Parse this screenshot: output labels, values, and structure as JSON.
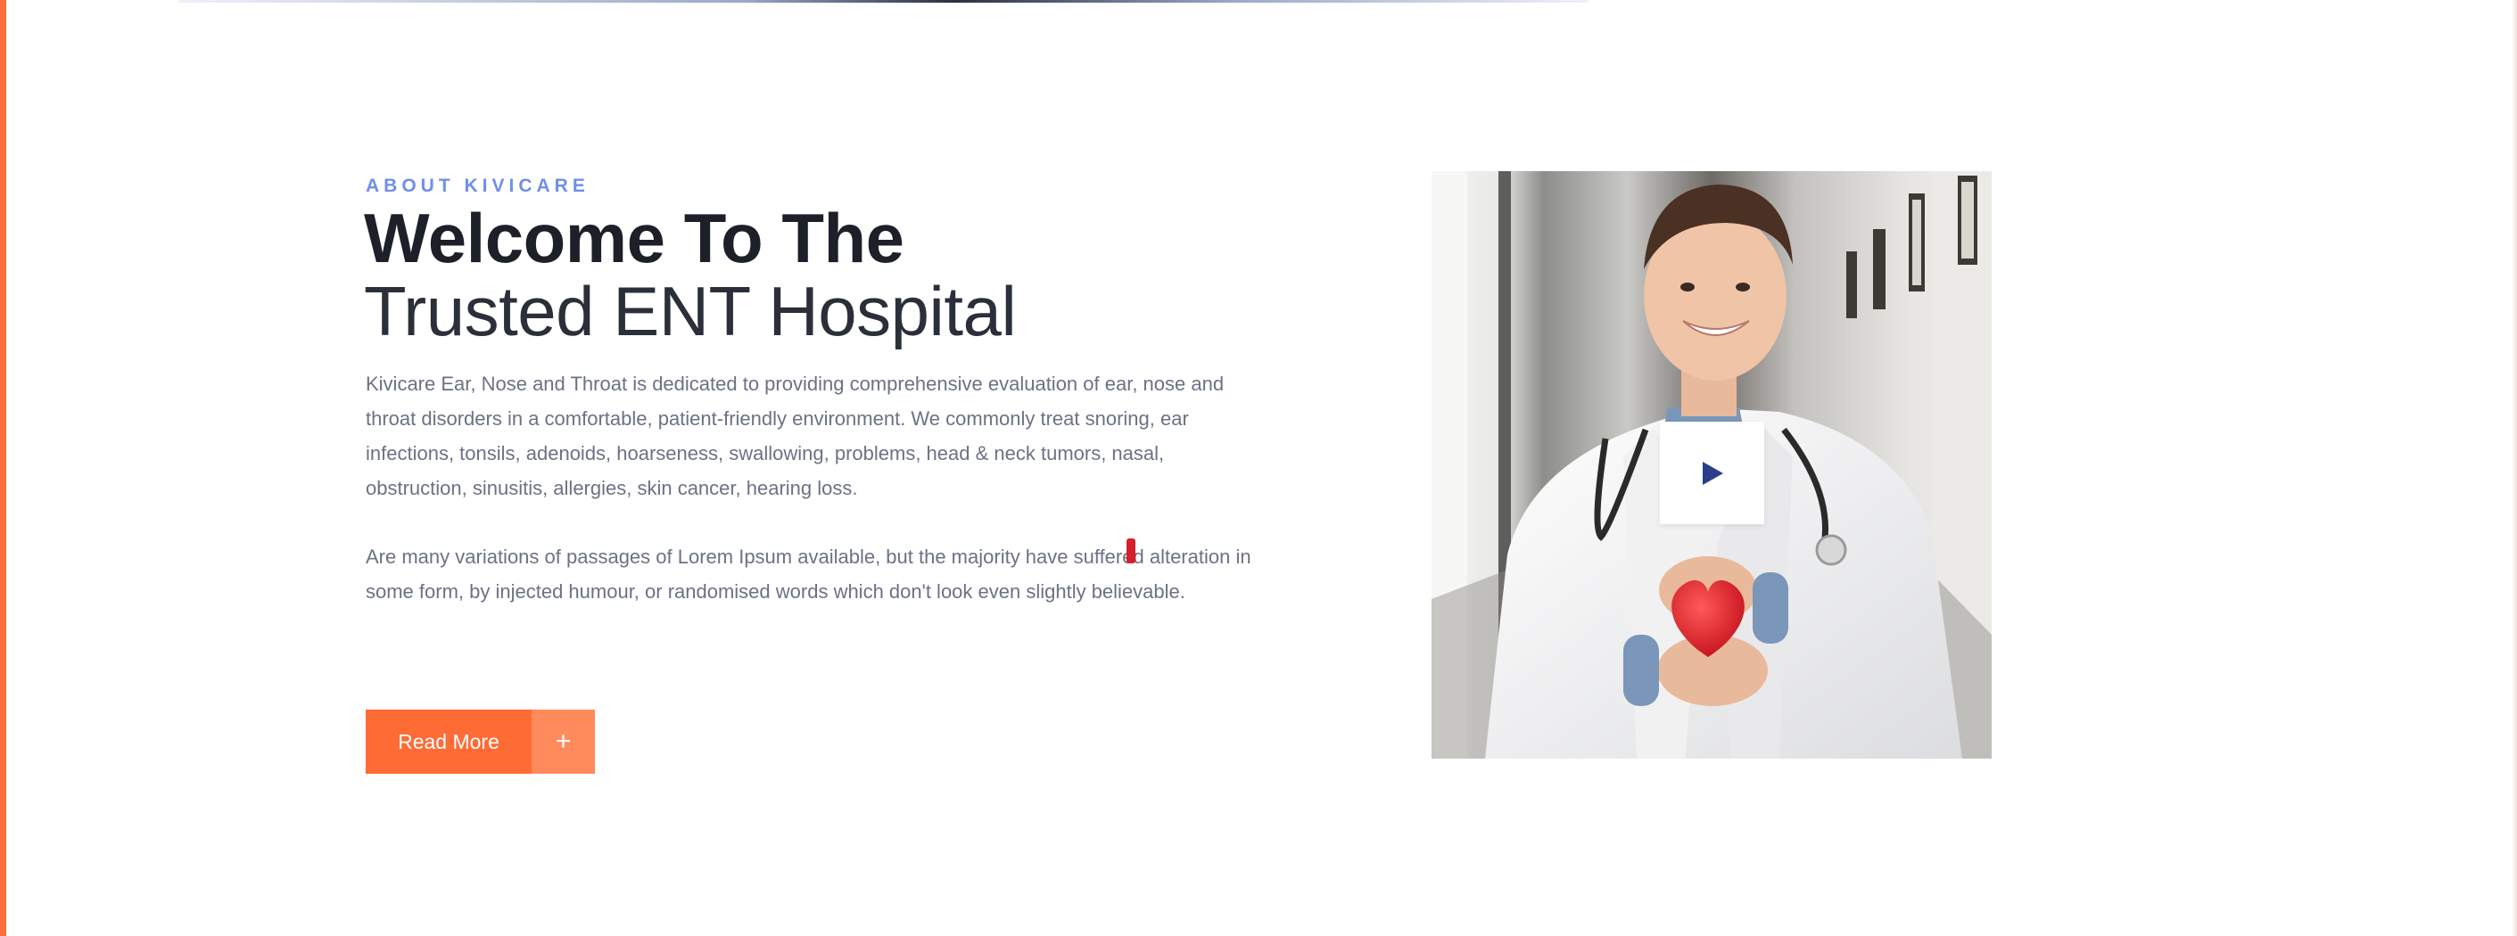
{
  "about": {
    "eyebrow": "ABOUT KIVICARE",
    "title_line1": "Welcome To The",
    "title_line2": "Trusted ENT Hospital",
    "paragraph1": "Kivicare Ear, Nose and Throat is dedicated to providing comprehensive evaluation of ear, nose and throat disorders in a comfortable, patient-friendly environment. We commonly treat snoring, ear infections, tonsils, adenoids, hoarseness, swallowing, problems, head & neck tumors, nasal, obstruction, sinusitis, allergies, skin cancer, hearing loss.",
    "paragraph2": "Are many variations of passages of Lorem Ipsum available, but the majority have suffered alteration in some form, by injected humour, or randomised words which don't look even slightly believable."
  },
  "cta": {
    "label": "Read More",
    "plus": "+"
  },
  "media": {
    "play_icon": "play-icon",
    "subject": "doctor-holding-heart"
  },
  "colors": {
    "accent": "#ff6b35",
    "accent_light": "#ff8a5c",
    "eyebrow": "#6f8fe8",
    "heading": "#1d2029",
    "body": "#6b7284",
    "play": "#2c3e8a"
  }
}
